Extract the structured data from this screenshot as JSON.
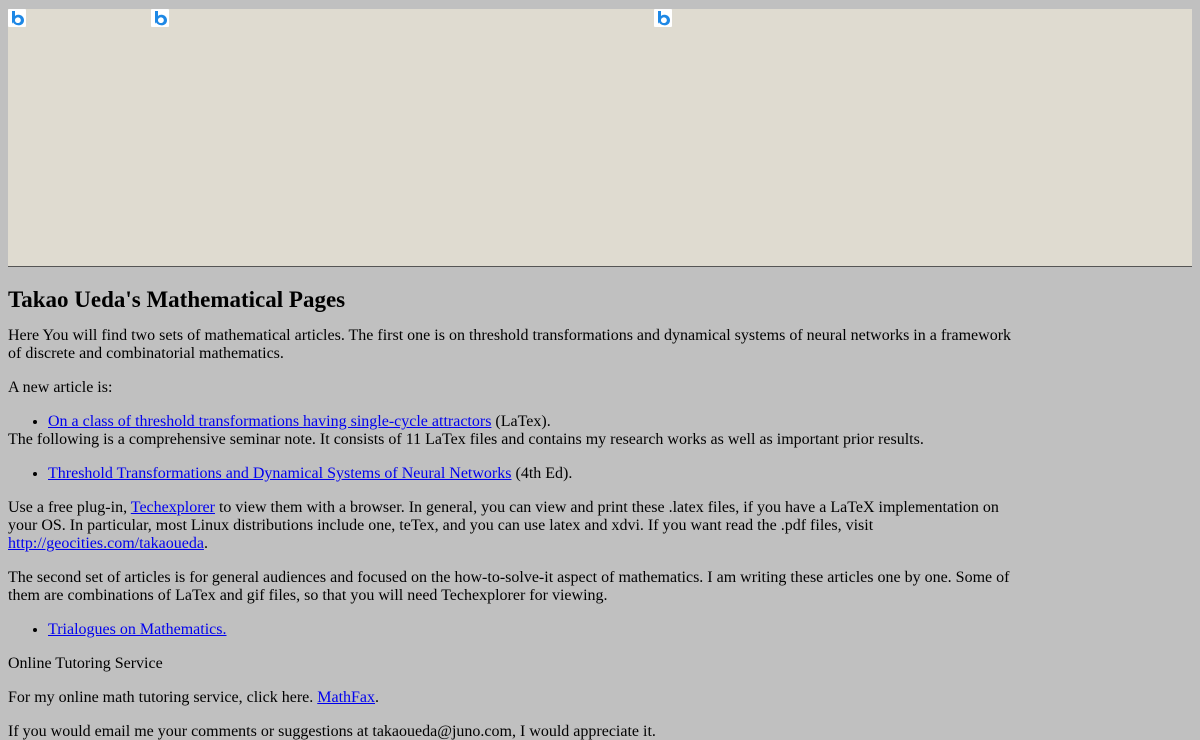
{
  "header": {
    "icons": [
      "bing-b-icon",
      "bing-b-icon",
      "bing-b-icon"
    ]
  },
  "main": {
    "title": "Takao Ueda's Mathematical Pages",
    "intro": "Here You will find two sets of mathematical articles. The first one is on threshold transformations and dynamical systems of neural networks in a framework of discrete and combinatorial mathematics.",
    "new_article_intro": "A new article is:",
    "new_article_link": "On a class of threshold transformations having single-cycle attractors",
    "new_article_suffix": " (LaTex).",
    "seminar_intro": "The following is a comprehensive seminar note. It consists of 11 LaTex files and contains my research works as well as important prior results.",
    "seminar_link": "Threshold Transformations and Dynamical Systems of Neural Networks",
    "seminar_suffix": " (4th Ed).",
    "plugin_text_1": "Use a free plug-in, ",
    "plugin_link": "Techexplorer",
    "plugin_text_2": " to view them with a browser.   In general, you can view and print these .latex files, if you have a LaTeX implementation on your OS.  In particular, most Linux distributions include one, teTex, and you can use latex and xdvi. If you want read the .pdf files, visit ",
    "geocities_link": "http://geocities.com/takaoueda",
    "plugin_text_3": ".",
    "second_set": "The second set of articles is for general audiences and focused on the how-to-solve-it aspect of mathematics. I am writing these articles one by one.  Some of them are combinations of LaTex and gif files, so that you will need Techexplorer for viewing.",
    "trialogues_link": "Trialogues on Mathematics.",
    "tutoring_heading": "Online Tutoring Service",
    "tutoring_text": "For my online math tutoring service, click here. ",
    "mathfax_link": "MathFax",
    "tutoring_suffix": ".",
    "email_text": "If you would email me your comments or suggestions at takaoueda@juno.com, I would appreciate it."
  },
  "colors": {
    "page_background": "#c0c0c0",
    "banner_background": "#dfdbd0",
    "link": "#0000ee",
    "icon_blue": "#1e88e5"
  }
}
